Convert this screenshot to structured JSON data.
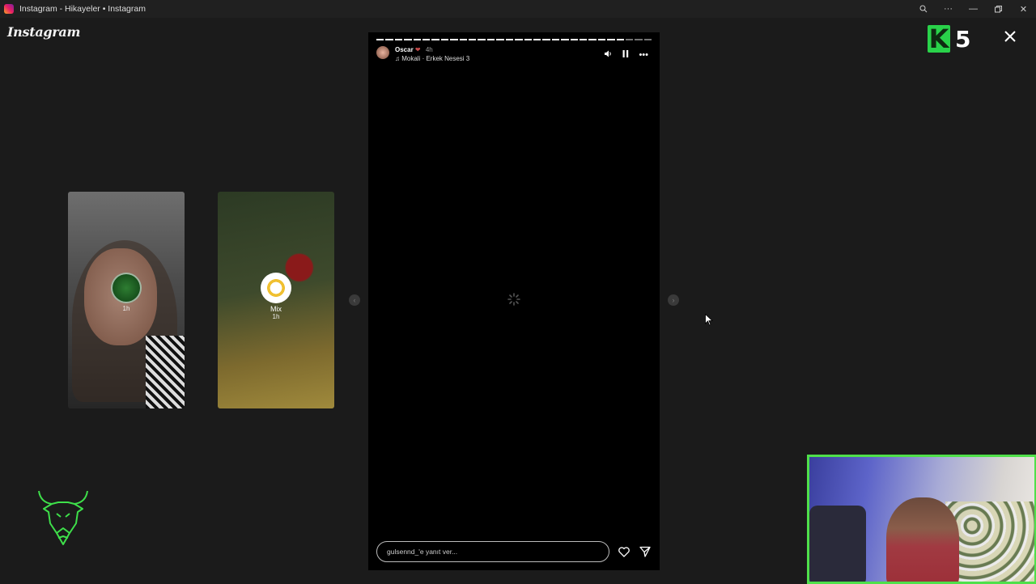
{
  "window": {
    "title": "Instagram - Hikayeler • Instagram",
    "controls": [
      "zoom-icon",
      "more-icon",
      "minimize-icon",
      "restore-icon",
      "close-icon"
    ]
  },
  "brand": {
    "logo_text": "Instagram"
  },
  "side_stories": [
    {
      "name": "",
      "time": "1h"
    },
    {
      "name": "Mix",
      "time": "1h"
    }
  ],
  "story": {
    "user": "Oscar",
    "heart": "❤",
    "time": "4h",
    "music": "Mokali · Erkek Nesesi 3",
    "progress_segments": 30,
    "progress_done": 27,
    "reply_placeholder": "gulsennd_'e yanıt ver..."
  },
  "overlay": {
    "k5_letter": "K",
    "k5_number": "5"
  },
  "colors": {
    "accent_green": "#29d24a",
    "webcam_border": "#4fe04a",
    "background": "#1b1b1b"
  }
}
